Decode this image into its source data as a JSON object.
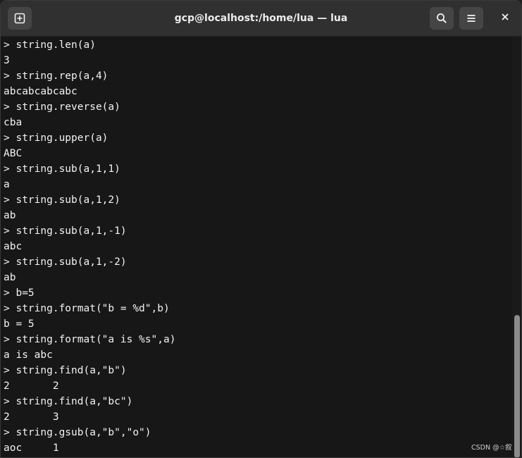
{
  "window": {
    "title": "gcp@localhost:/home/lua — lua"
  },
  "titlebar": {
    "new_tab_icon": "new-tab-icon",
    "search_icon": "search-icon",
    "menu_icon": "hamburger-menu-icon",
    "close_icon": "close-icon"
  },
  "terminal": {
    "lines": [
      "> string.len(a)",
      "3",
      "> string.rep(a,4)",
      "abcabcabcabc",
      "> string.reverse(a)",
      "cba",
      "> string.upper(a)",
      "ABC",
      "> string.sub(a,1,1)",
      "a",
      "> string.sub(a,1,2)",
      "ab",
      "> string.sub(a,1,-1)",
      "abc",
      "> string.sub(a,1,-2)",
      "ab",
      "> b=5",
      "> string.format(\"b = %d\",b)",
      "b = 5",
      "> string.format(\"a is %s\",a)",
      "a is abc",
      "> string.find(a,\"b\")",
      "2       2",
      "> string.find(a,\"bc\")",
      "2       3",
      "> string.gsub(a,\"b\",\"o\")",
      "aoc     1"
    ]
  },
  "scrollbar": {
    "position_fraction": 0.66,
    "visible_fraction": 0.34
  },
  "watermark": {
    "text": "CSDN @☆叙"
  },
  "colors": {
    "background": "#171717",
    "titlebar": "#303030",
    "text": "#f2f2f2",
    "button": "#454545",
    "scroll_thumb": "#8b8b8b"
  }
}
